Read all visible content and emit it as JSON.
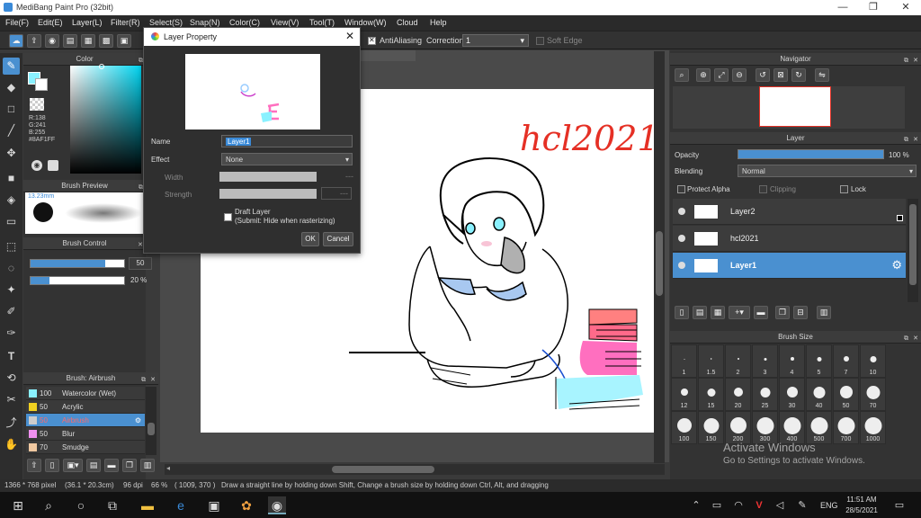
{
  "app": {
    "title": "MediBang Paint Pro (32bit)"
  },
  "menu": [
    "File(F)",
    "Edit(E)",
    "Layer(L)",
    "Filter(R)",
    "Select(S)",
    "Snap(N)",
    "Color(C)",
    "View(V)",
    "Tool(T)",
    "Window(W)",
    "Cloud",
    "Help"
  ],
  "toolbar": {
    "antialiasing_label": "AntiAliasing",
    "correction_label": "Correction",
    "correction_value": "1",
    "soft_edge_label": "Soft Edge"
  },
  "color_panel": {
    "title": "Color",
    "r": "R:138",
    "g": "G:241",
    "b": "B:255",
    "hex": "#8AF1FF",
    "accent": "#8AF1FF"
  },
  "brush_preview": {
    "title": "Brush Preview",
    "size": "13.23mm"
  },
  "brush_control": {
    "title": "Brush Control",
    "size_value": "50",
    "opacity_value": "20 %",
    "size_fraction": 0.8,
    "opacity_fraction": 0.2
  },
  "brush_list": {
    "title": "Brush: Airbrush",
    "items": [
      {
        "size": "100",
        "name": "Watercolor (Wet)",
        "color": "#8AF1FF"
      },
      {
        "size": "50",
        "name": "Acrylic",
        "color": "#f0d020"
      },
      {
        "size": "50",
        "name": "Airbrush",
        "color": "#cccccc"
      },
      {
        "size": "50",
        "name": "Blur",
        "color": "#f090f0"
      },
      {
        "size": "70",
        "name": "Smudge",
        "color": "#f0c8a0"
      }
    ]
  },
  "dialog": {
    "title": "Layer Property",
    "name_label": "Name",
    "name_value": "Layer1",
    "effect_label": "Effect",
    "effect_value": "None",
    "width_label": "Width",
    "strength_label": "Strength",
    "draft_label": "Draft Layer",
    "draft_note": "(Submit: Hide when rasterizing)",
    "ok": "OK",
    "cancel": "Cancel"
  },
  "canvas": {
    "signature": "hcl2021"
  },
  "navigator": {
    "title": "Navigator"
  },
  "layer_panel": {
    "title": "Layer",
    "opacity_label": "Opacity",
    "opacity_value": "100 %",
    "opacity_fraction": 1.0,
    "blending_label": "Blending",
    "blending_value": "Normal",
    "protect_alpha": "Protect Alpha",
    "clipping": "Clipping",
    "lock": "Lock",
    "layers": [
      {
        "name": "Layer2"
      },
      {
        "name": "hcl2021"
      },
      {
        "name": "Layer1"
      }
    ]
  },
  "brush_size": {
    "title": "Brush Size",
    "sizes": [
      "1",
      "1.5",
      "2",
      "3",
      "4",
      "5",
      "7",
      "10",
      "12",
      "15",
      "20",
      "25",
      "30",
      "40",
      "50",
      "70",
      "100",
      "150",
      "200",
      "300",
      "400",
      "500",
      "700",
      "1000"
    ]
  },
  "status": {
    "dims": "1366 * 768 pixel",
    "cm": "(36.1 * 20.3cm)",
    "dpi": "96 dpi",
    "zoom": "66 %",
    "coords": "( 1009, 370 )",
    "hint": "Draw a straight line by holding down Shift, Change a brush size by holding down Ctrl, Alt, and dragging"
  },
  "watermark": {
    "line1": "Activate Windows",
    "line2": "Go to Settings to activate Windows."
  },
  "taskbar": {
    "lang": "ENG",
    "time": "11:51 AM",
    "date": "28/5/2021"
  }
}
